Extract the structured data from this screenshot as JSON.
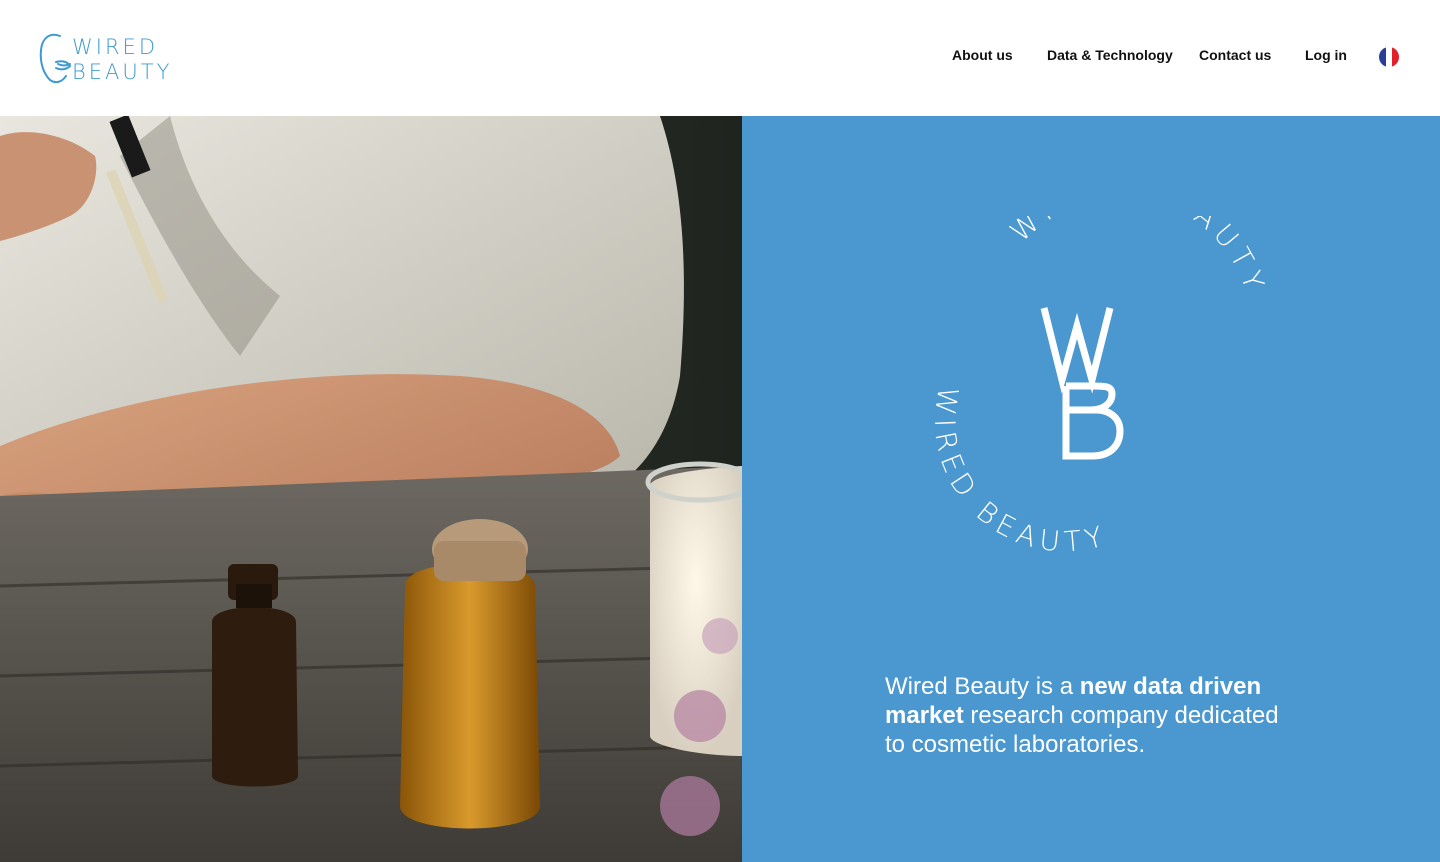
{
  "brand": {
    "logo_line1": "WIRED",
    "logo_line2": "BEAUTY",
    "emblem_ring_text": "WIRED BEAUTY",
    "emblem_letters": "WB",
    "accent_color": "#3d9ad1",
    "panel_color": "#4a98cf"
  },
  "nav": {
    "items": [
      {
        "label": "About us"
      },
      {
        "label": "Data & Technology"
      },
      {
        "label": "Contact us"
      },
      {
        "label": "Log in"
      }
    ],
    "language_flag": "france-flag-icon"
  },
  "hero": {
    "image": "hand-applying-oil-with-dropper-bottles-and-candle",
    "tagline": {
      "part1": "Wired Beauty is a ",
      "bold": "new data driven market",
      "part2": " research company dedicated to cosmetic laboratories."
    }
  }
}
